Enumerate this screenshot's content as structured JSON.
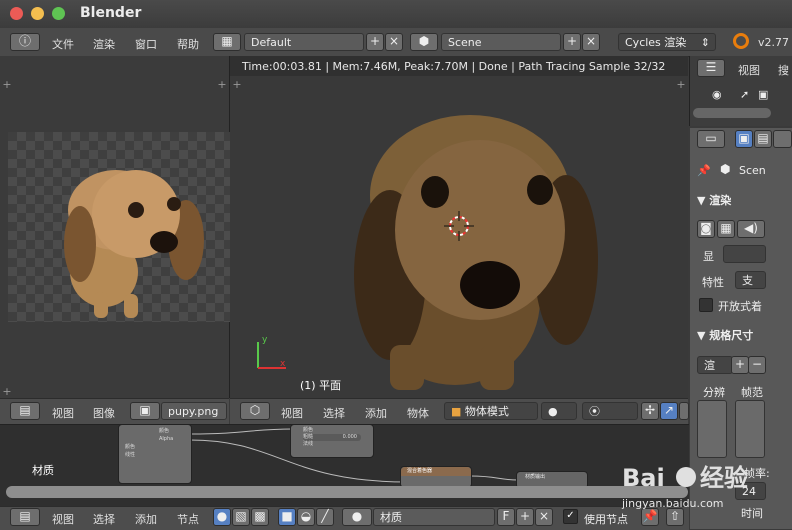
{
  "app": {
    "title": "Blender"
  },
  "topbar": {
    "menus": [
      "文件",
      "渲染",
      "窗口",
      "帮助"
    ],
    "layout_name": "Default",
    "scene_name": "Scene",
    "engine": "Cycles 渲染",
    "version": "v2.77"
  },
  "render_status": "Time:00:03.81 | Mem:7.46M, Peak:7.70M | Done | Path Tracing Sample 32/32",
  "viewport": {
    "object_label": "(1) 平面",
    "mode": "物体模式"
  },
  "image_editor": {
    "menus": [
      "视图",
      "图像"
    ],
    "image_name": "pupy.png"
  },
  "viewport_menus": [
    "视图",
    "选择",
    "添加",
    "物体"
  ],
  "outliner": {
    "menu": "视图",
    "search": "搜"
  },
  "properties": {
    "scene": "Scen",
    "render_section": "渲染",
    "display_label": "显",
    "feature_label": "特性",
    "feature_value": "支",
    "open_shading": "开放式着",
    "dimensions_section": "规格尺寸",
    "preset": "渲",
    "resolution_label": "分辨",
    "frame_label": "帧范",
    "frame_rate_label": "帧率:",
    "frame_rate_value": "24",
    "time_label": "时间"
  },
  "node_editor": {
    "label": "材质",
    "menus": [
      "视图",
      "选择",
      "添加",
      "节点"
    ],
    "material": "材质",
    "use_nodes_label": "使用节点",
    "f_label": "F",
    "node_labels": [
      "颜色",
      "Alpha",
      "颜色",
      "线性",
      "颜色",
      "粗糙",
      "0.000",
      "法线",
      "混合着色器",
      "材质输出"
    ]
  },
  "watermark": "jingyan.baidu.com"
}
